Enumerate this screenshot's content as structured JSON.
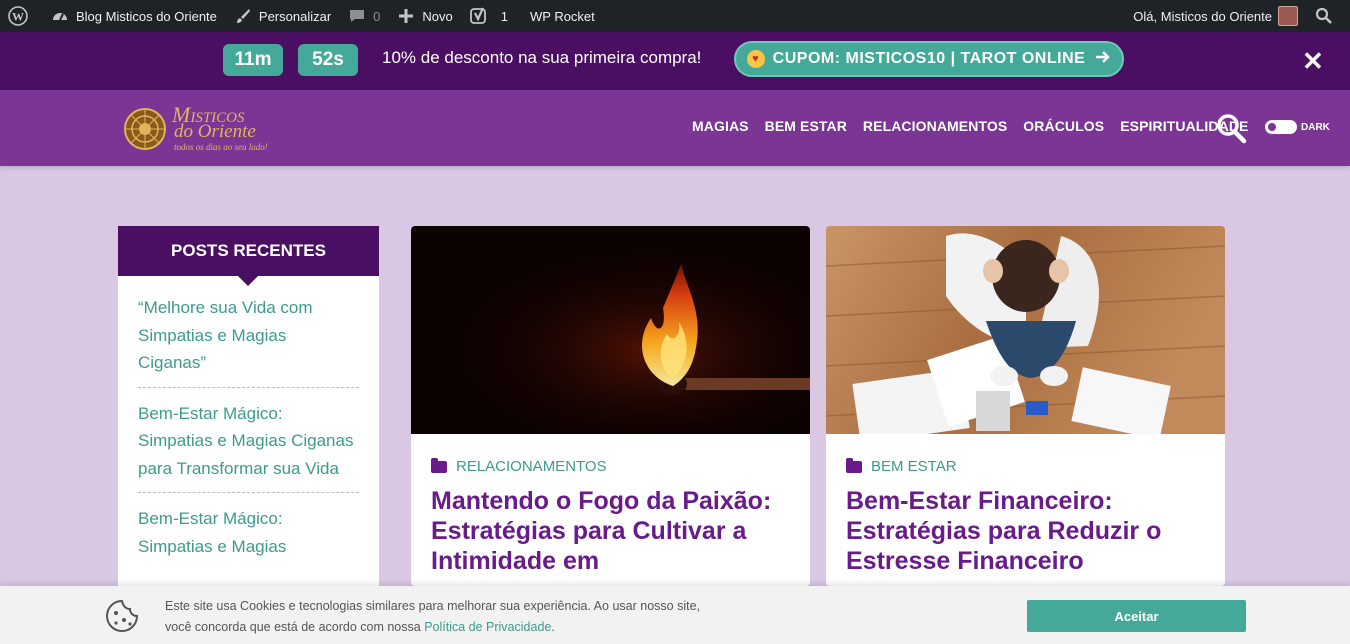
{
  "admin_bar": {
    "site_name": "Blog Misticos do Oriente",
    "customize": "Personalizar",
    "comments_count": "0",
    "new_label": "Novo",
    "yoast_count": "1",
    "wp_rocket": "WP Rocket",
    "greeting": "Olá, Misticos do Oriente"
  },
  "promo": {
    "timer_minutes": "11m",
    "timer_seconds": "52s",
    "text": "10% de desconto na sua primeira compra!",
    "coupon": "CUPOM: MISTICOS10 | TAROT ONLINE",
    "close": "✕"
  },
  "header": {
    "logo_line1": "Misticos",
    "logo_line2": "do Oriente",
    "logo_tagline": "todos os dias ao seu lado!",
    "nav": [
      "MAGIAS",
      "BEM ESTAR",
      "RELACIONAMENTOS",
      "ORÁCULOS",
      "ESPIRITUALIDADE"
    ],
    "dark_label": "DARK"
  },
  "sidebar": {
    "title": "POSTS RECENTES",
    "posts": [
      "“Melhore sua Vida com Simpatias e Magias Ciganas”",
      "Bem-Estar Mágico: Simpatias e Magias Ciganas para Transformar sua Vida",
      "Bem-Estar Mágico: Simpatias e Magias"
    ]
  },
  "cards": [
    {
      "category": "RELACIONAMENTOS",
      "title": "Mantendo o Fogo da Paixão: Estratégias para Cultivar a Intimidade em"
    },
    {
      "category": "BEM ESTAR",
      "title": "Bem-Estar Financeiro: Estratégias para Reduzir o Estresse Financeiro"
    }
  ],
  "cookie": {
    "text_line1": "Este site usa Cookies e tecnologias similares para melhorar sua experiência. Ao usar nosso site,",
    "text_line2": "você concorda que está de acordo com nossa ",
    "link": "Política de Privacidade",
    "suffix": ".",
    "accept": "Aceitar"
  },
  "colors": {
    "admin_bar": "#1d2327",
    "promo_bg": "#4a0f63",
    "header_bg": "#7b3695",
    "accent_teal": "#45a99a",
    "title_purple": "#6a1b8a",
    "page_bg": "#d9c7e3"
  }
}
